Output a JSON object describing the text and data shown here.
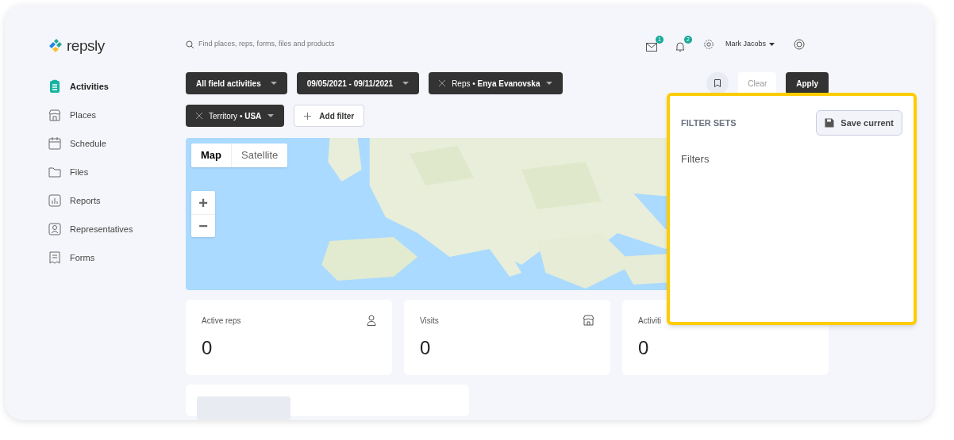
{
  "brand": "repsly",
  "search": {
    "placeholder": "Find places, reps, forms, files and products"
  },
  "header": {
    "mail_badge": "1",
    "bell_badge": "2",
    "user": "Mark Jacobs"
  },
  "nav": [
    {
      "label": "Activities",
      "selected": true
    },
    {
      "label": "Places",
      "selected": false
    },
    {
      "label": "Schedule",
      "selected": false
    },
    {
      "label": "Files",
      "selected": false
    },
    {
      "label": "Reports",
      "selected": false
    },
    {
      "label": "Representatives",
      "selected": false
    },
    {
      "label": "Forms",
      "selected": false
    }
  ],
  "filter_rows": [
    [
      {
        "kind": "dropdown",
        "label": "All field activities"
      },
      {
        "kind": "dropdown",
        "label": "09/05/2021 - 09/11/2021"
      },
      {
        "kind": "removable",
        "label": "Reps",
        "separator": "•",
        "value": "Enya Evanovska"
      }
    ],
    [
      {
        "kind": "removable",
        "label": "Territory",
        "separator": "•",
        "value": "USA"
      },
      {
        "kind": "add",
        "label": "Add filter"
      }
    ]
  ],
  "actions": {
    "clear": "Clear",
    "apply": "Apply"
  },
  "map": {
    "view_toggle": [
      {
        "label": "Map",
        "selected": true
      },
      {
        "label": "Satellite",
        "selected": false
      }
    ],
    "zoom_in": "+",
    "zoom_out": "−"
  },
  "stats": [
    {
      "label": "Active reps",
      "value": "0"
    },
    {
      "label": "Visits",
      "value": "0"
    },
    {
      "label": "Activiti",
      "value": "0"
    }
  ],
  "filter_sets": {
    "title": "FILTER SETS",
    "save_button": "Save current",
    "section": "Filters"
  }
}
